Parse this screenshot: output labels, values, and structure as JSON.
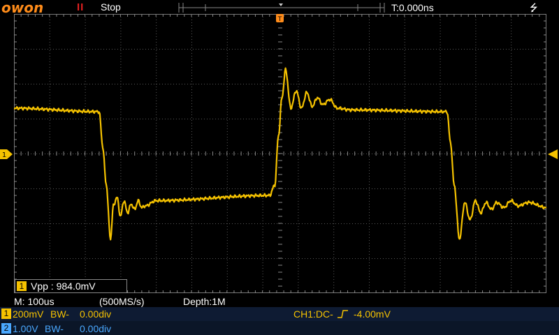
{
  "topbar": {
    "logo": "owon",
    "run_glyph": "II",
    "status": "Stop",
    "trigger_time": "T:0.000ns",
    "usb_icon": "usb-icon"
  },
  "colors": {
    "ch1": "#f5c200",
    "ch2": "#4aa8ff",
    "grid": "#5a5a5a",
    "logo": "#ff8c1a",
    "run": "#e02020"
  },
  "measure": {
    "channel": "1",
    "text": "Vpp : 984.0mV"
  },
  "timebase": {
    "main": "M: 100us",
    "sample_rate": "(500MS/s)",
    "depth": "Depth:1M"
  },
  "ch1": {
    "badge": "1",
    "scale": "200mV",
    "bw": "BW-",
    "offset": "0.00div"
  },
  "ch2": {
    "badge": "2",
    "scale": "1.00V",
    "bw": "BW-",
    "offset": "0.00div"
  },
  "trigger": {
    "label": "CH1:DC-",
    "level": "-4.00mV"
  },
  "chart_data": {
    "type": "line",
    "title": "",
    "xlabel": "",
    "ylabel": "",
    "x_divisions": 15,
    "y_divisions": 8,
    "xlim": [
      -7.5,
      7.5
    ],
    "ylim": [
      -4,
      4
    ],
    "grid": true,
    "series": [
      {
        "name": "",
        "color": "#f5c200",
        "x": [
          -7.5,
          -5.1,
          -5.0,
          -4.9,
          -4.78,
          -4.7,
          -4.6,
          -4.5,
          -4.4,
          -4.3,
          -4.2,
          -4.1,
          -4.0,
          -3.9,
          -3.8,
          -3.5,
          -0.3,
          -0.15,
          -0.05,
          0.05,
          0.15,
          0.3,
          0.45,
          0.6,
          0.75,
          0.9,
          1.05,
          1.2,
          1.4,
          1.6,
          2.0,
          4.7,
          4.8,
          4.9,
          5.05,
          5.2,
          5.35,
          5.5,
          5.65,
          5.8,
          5.95,
          6.1,
          6.3,
          6.5,
          6.7,
          7.0,
          7.5
        ],
        "y": [
          1.3,
          1.2,
          0.2,
          -0.9,
          -2.45,
          -1.5,
          -1.25,
          -1.8,
          -1.35,
          -1.7,
          -1.45,
          -1.6,
          -1.35,
          -1.55,
          -1.5,
          -1.35,
          -1.2,
          -0.9,
          0.5,
          1.6,
          2.4,
          1.3,
          1.8,
          1.3,
          1.75,
          1.35,
          1.6,
          1.4,
          1.55,
          1.3,
          1.25,
          1.2,
          0.3,
          -0.9,
          -2.45,
          -1.4,
          -1.9,
          -1.35,
          -1.7,
          -1.4,
          -1.6,
          -1.4,
          -1.55,
          -1.35,
          -1.5,
          -1.4,
          -1.55
        ]
      }
    ]
  }
}
